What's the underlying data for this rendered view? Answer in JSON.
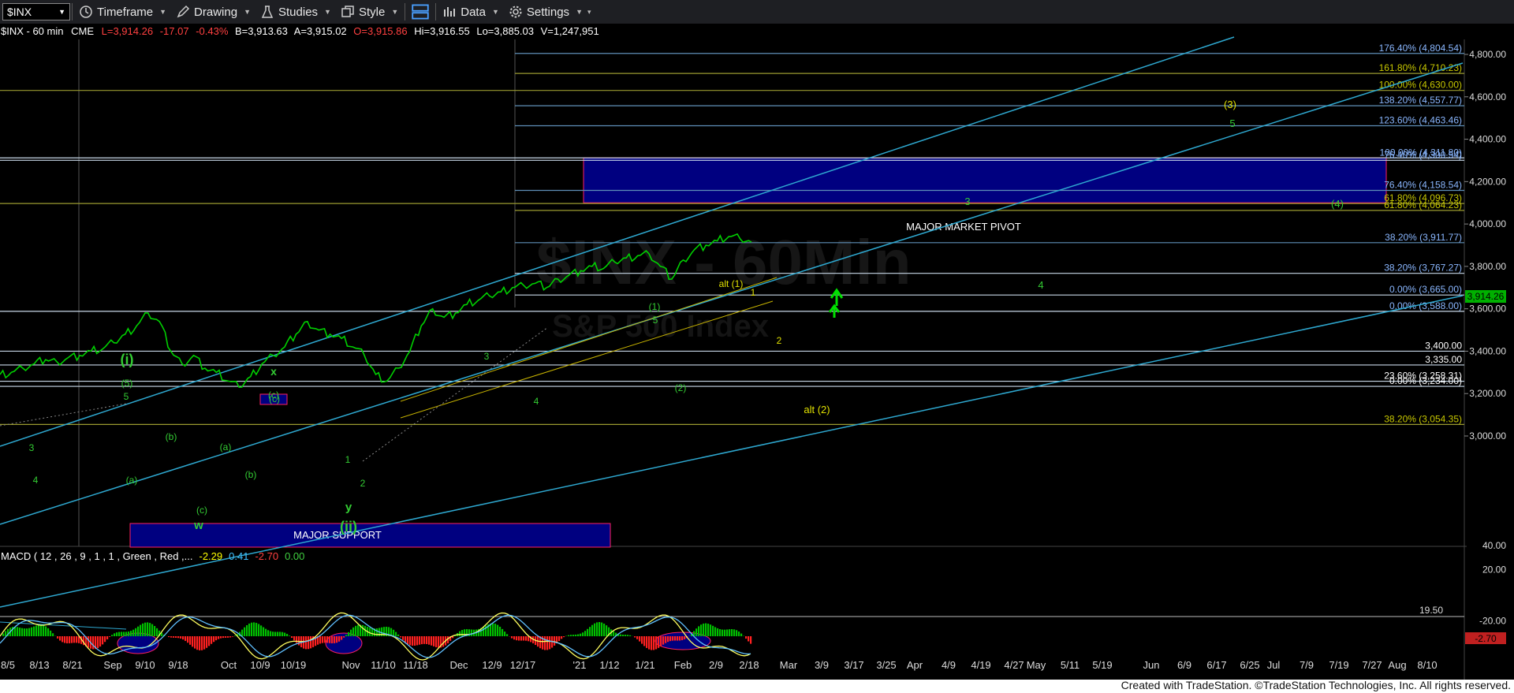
{
  "toolbar": {
    "symbol": "$INX",
    "timeframe": "Timeframe",
    "drawing": "Drawing",
    "studies": "Studies",
    "style": "Style",
    "data": "Data",
    "settings": "Settings"
  },
  "header": {
    "symbol": "$INX - 60 min",
    "exchange": "CME",
    "last": "L=3,914.26",
    "change": "-17.07",
    "pct": "-0.43%",
    "bid": "B=3,913.63",
    "ask": "A=3,915.02",
    "open": "O=3,915.86",
    "high": "Hi=3,916.55",
    "low": "Lo=3,885.03",
    "volume": "V=1,247,951"
  },
  "watermark": {
    "line1": "$INX - 60Min",
    "line2": "S&P 500 Index"
  },
  "macd": {
    "label": "MACD ( 12 , 26 , 9 , 1 , 1 , Green , Red ,...",
    "v1": "-2.29",
    "v2": "0.41",
    "v3": "-2.70",
    "v4": "0.00",
    "level_label": "19.50",
    "current_label": "-2.70"
  },
  "colors": {
    "price": "#00d000",
    "fib": "#8ab7ff",
    "fibYellow": "#c8c800",
    "channel": "#2ea8d0",
    "pivot": "#000080",
    "waveGreen": "#33cc33",
    "waveYellow": "#e0e000",
    "macdRed": "#ff2020"
  },
  "chart_data": {
    "type": "line",
    "title": "$INX - 60 min",
    "price_axis": {
      "ticks": [
        3000,
        3200,
        3400,
        3600,
        3800,
        4000,
        4200,
        4400,
        4600,
        4800
      ],
      "labels": [
        "3,000.00",
        "3,200.00",
        "3,400.00",
        "3,600.00",
        "3,800.00",
        "4,000.00",
        "4,200.00",
        "4,400.00",
        "4,600.00",
        "4,800.00"
      ],
      "ylim": [
        2966,
        4950
      ]
    },
    "current_price": {
      "value": 3914.26,
      "label": "3,914.26"
    },
    "date_labels": [
      "8/5",
      "8/13",
      "8/21",
      "Sep",
      "9/10",
      "9/18",
      "Oct",
      "10/9",
      "10/19",
      "Nov",
      "11/10",
      "11/18",
      "Dec",
      "12/9",
      "12/17",
      "'21",
      "1/12",
      "1/21",
      "Feb",
      "2/9",
      "2/18",
      "Mar",
      "3/9",
      "3/17",
      "3/25",
      "Apr",
      "4/9",
      "4/19",
      "4/27",
      "May",
      "5/11",
      "5/19",
      "Jun",
      "6/9",
      "6/17",
      "6/25",
      "Jul",
      "7/9",
      "7/19",
      "7/27",
      "Aug",
      "8/10"
    ],
    "series": [
      {
        "values": [
          3290,
          3300,
          3320,
          3340,
          3360,
          3350,
          3370,
          3380,
          3400,
          3410,
          3440,
          3480,
          3520,
          3580,
          3540,
          3400,
          3340,
          3380,
          3320,
          3300,
          3260,
          3230,
          3280,
          3340,
          3380,
          3420,
          3480,
          3540,
          3500,
          3480,
          3460,
          3420,
          3380,
          3290,
          3260,
          3320,
          3400,
          3520,
          3600,
          3560,
          3580,
          3620,
          3640,
          3660,
          3680,
          3700,
          3710,
          3720,
          3700,
          3740,
          3760,
          3780,
          3800,
          3790,
          3820,
          3840,
          3850,
          3860,
          3800,
          3740,
          3830,
          3880,
          3900,
          3920,
          3940,
          3930,
          3914
        ]
      }
    ],
    "macd_axis": {
      "ticks": [
        40,
        20,
        -20
      ],
      "labels": [
        "40.00",
        "20.00",
        "-20.00"
      ]
    },
    "fib_levels": [
      {
        "label": "176.40% (4,804.54)",
        "value": 4804.54
      },
      {
        "label": "161.80% (4,710.23)",
        "value": 4710.23
      },
      {
        "label": "100.00% (4,630.00)",
        "value": 4630.0
      },
      {
        "label": "138.20% (4,557.77)",
        "value": 4557.77
      },
      {
        "label": "123.60% (4,463.46)",
        "value": 4463.46
      },
      {
        "label": "100.00% (4,311.80)",
        "value": 4311.8
      },
      {
        "label": "76.40% (4,300.54)",
        "value": 4300.54
      },
      {
        "label": "76.40% (4,158.54)",
        "value": 4158.54
      },
      {
        "label": "61.80% (4,096.73)",
        "value": 4096.73
      },
      {
        "label": "61.80% (4,064.23)",
        "value": 4064.23
      },
      {
        "label": "38.20% (3,911.77)",
        "value": 3911.77
      },
      {
        "label": "38.20% (3,767.27)",
        "value": 3767.27
      },
      {
        "label": "0.00% (3,665.00)",
        "value": 3665.0
      },
      {
        "label": "0.00% (3,588.00)",
        "value": 3588.0
      },
      {
        "label": "3,400.00",
        "value": 3400.0
      },
      {
        "label": "3,335.00",
        "value": 3335.0
      },
      {
        "label": "23.60% (3,258.31)",
        "value": 3258.31
      },
      {
        "label": "0.00% (3,234.00)",
        "value": 3234.0
      },
      {
        "label": "38.20% (3,054.35)",
        "value": 3054.35
      }
    ],
    "zones": [
      {
        "label": "MAJOR MARKET PIVOT",
        "top": 4311.8,
        "bottom": 4100
      },
      {
        "label": "MAJOR SUPPORT",
        "top": 3044,
        "bottom": 2960
      }
    ],
    "wave_labels": [
      "(i)",
      "(5)",
      "5",
      "3",
      "4",
      "(a)",
      "(b)",
      "(c)",
      "w",
      "(a)",
      "(b)",
      "(c)",
      "x",
      "(c)",
      "y",
      "(ii)",
      "1",
      "2",
      "3",
      "4",
      "5",
      "(1)",
      "(2)",
      "alt (1)",
      "1",
      "2",
      "alt (2)",
      "3",
      "4",
      "(3)",
      "5",
      "(4)"
    ]
  },
  "footer": "Created with TradeStation. ©TradeStation Technologies, Inc. All rights reserved."
}
